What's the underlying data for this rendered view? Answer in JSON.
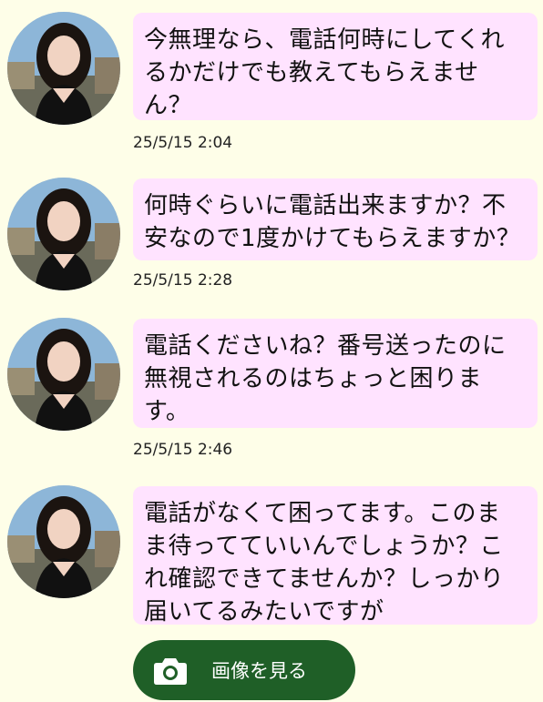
{
  "messages": [
    {
      "avatar_icon": "profile-photo-icon",
      "text": "今無理なら、電話何時にしてくれ\nるかだけでも教えてもらえませ\nん？",
      "timestamp": "25/5/15 2:04"
    },
    {
      "avatar_icon": "profile-photo-icon",
      "text": "何時ぐらいに電話出来ますか？不\n安なので1度かけてもらえますか？",
      "timestamp": "25/5/15 2:28"
    },
    {
      "avatar_icon": "profile-photo-icon",
      "text": "電話くださいね？番号送ったのに\n無視されるのはちょっと困りま\nす。",
      "timestamp": "25/5/15 2:46"
    },
    {
      "avatar_icon": "profile-photo-icon",
      "text": "電話がなくて困ってます。このま\nま待ってていいんでしょうか？こ\nれ確認できてませんか？しっかり\n届いてるみたいですが",
      "timestamp": ""
    }
  ],
  "view_image_button": {
    "label": "画像を見る",
    "icon": "camera-icon"
  },
  "colors": {
    "background": "#fefee8",
    "bubble": "#ffe3ff",
    "button": "#1f5f27"
  }
}
